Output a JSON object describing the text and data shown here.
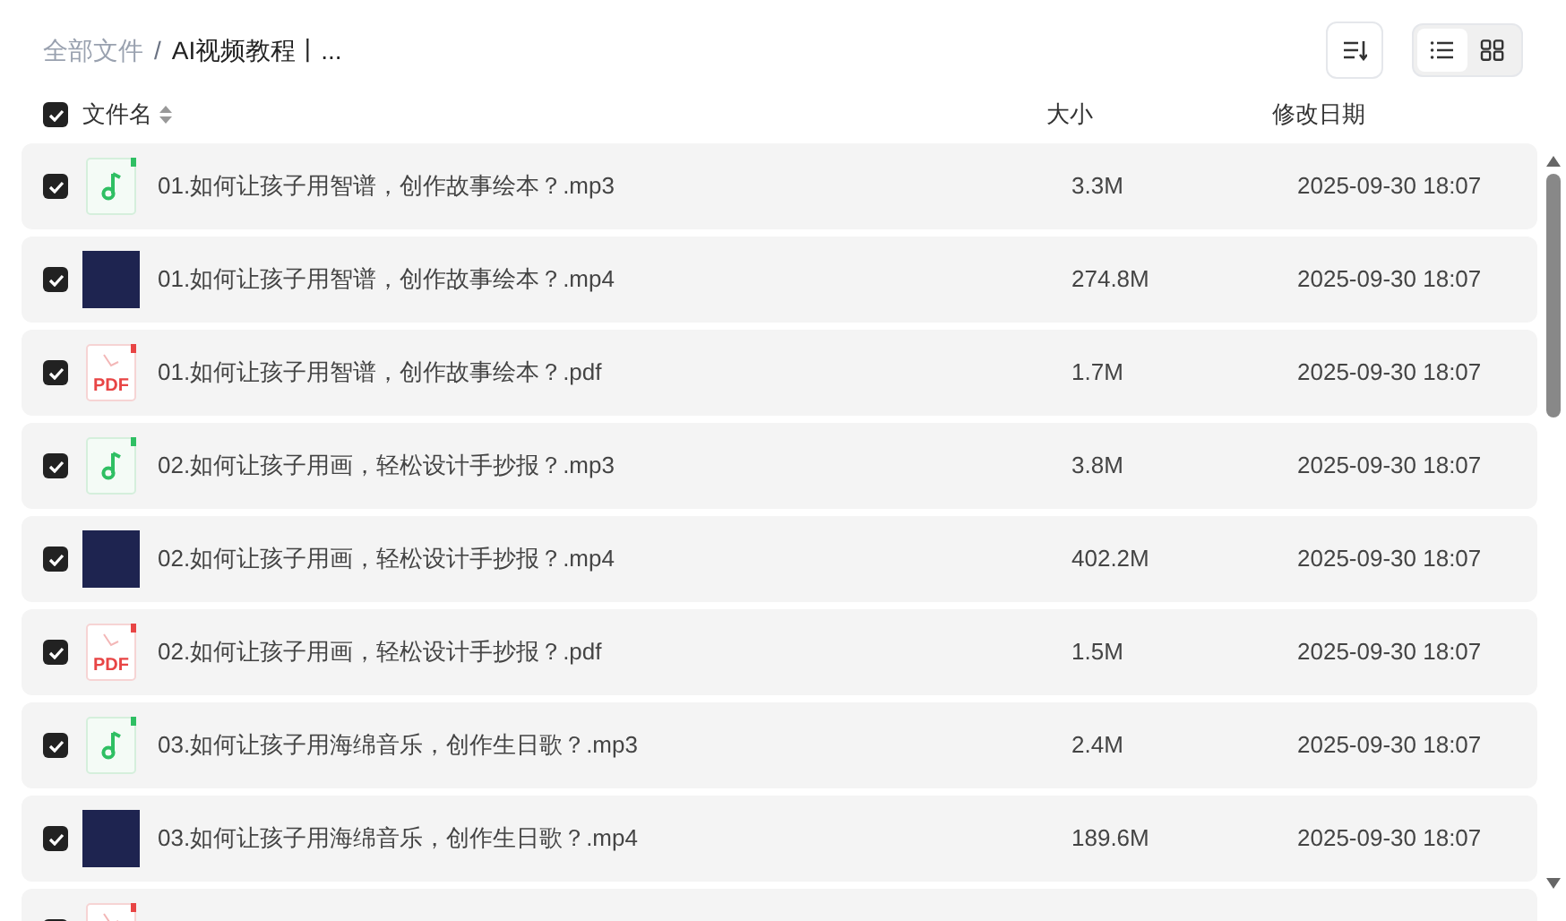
{
  "breadcrumb": [
    {
      "label": "全部文件",
      "current": false
    },
    {
      "separator": "/",
      "label": "AI视频教程丨...",
      "current": true
    }
  ],
  "view_toggle": [
    {
      "kind": "list",
      "selected": true
    },
    {
      "kind": "grid",
      "selected": false
    }
  ],
  "table": {
    "select_all": {
      "checked": true
    },
    "columns": [
      "文件名",
      "大小",
      "修改日期"
    ],
    "rows": [
      {
        "kind": "audio",
        "checked": true,
        "name": "01.如何让孩子用智谱，创作故事绘本？.mp3",
        "size": "3.3M",
        "modified": "2025-09-30 18:07"
      },
      {
        "kind": "video",
        "checked": true,
        "name": "01.如何让孩子用智谱，创作故事绘本？.mp4",
        "size": "274.8M",
        "modified": "2025-09-30 18:07"
      },
      {
        "kind": "pdf",
        "checked": true,
        "icon_label": "PDF",
        "name": "01.如何让孩子用智谱，创作故事绘本？.pdf",
        "size": "1.7M",
        "modified": "2025-09-30 18:07"
      },
      {
        "kind": "audio",
        "checked": true,
        "name": "02.如何让孩子用画，轻松设计手抄报？.mp3",
        "size": "3.8M",
        "modified": "2025-09-30 18:07"
      },
      {
        "kind": "video",
        "checked": true,
        "name": "02.如何让孩子用画，轻松设计手抄报？.mp4",
        "size": "402.2M",
        "modified": "2025-09-30 18:07"
      },
      {
        "kind": "pdf",
        "checked": true,
        "icon_label": "PDF",
        "name": "02.如何让孩子用画，轻松设计手抄报？.pdf",
        "size": "1.5M",
        "modified": "2025-09-30 18:07"
      },
      {
        "kind": "audio",
        "checked": true,
        "name": "03.如何让孩子用海绵音乐，创作生日歌？.mp3",
        "size": "2.4M",
        "modified": "2025-09-30 18:07"
      },
      {
        "kind": "video",
        "checked": true,
        "name": "03.如何让孩子用海绵音乐，创作生日歌？.mp4",
        "size": "189.6M",
        "modified": "2025-09-30 18:07"
      },
      {
        "kind": "pdf",
        "checked": true
      }
    ]
  }
}
